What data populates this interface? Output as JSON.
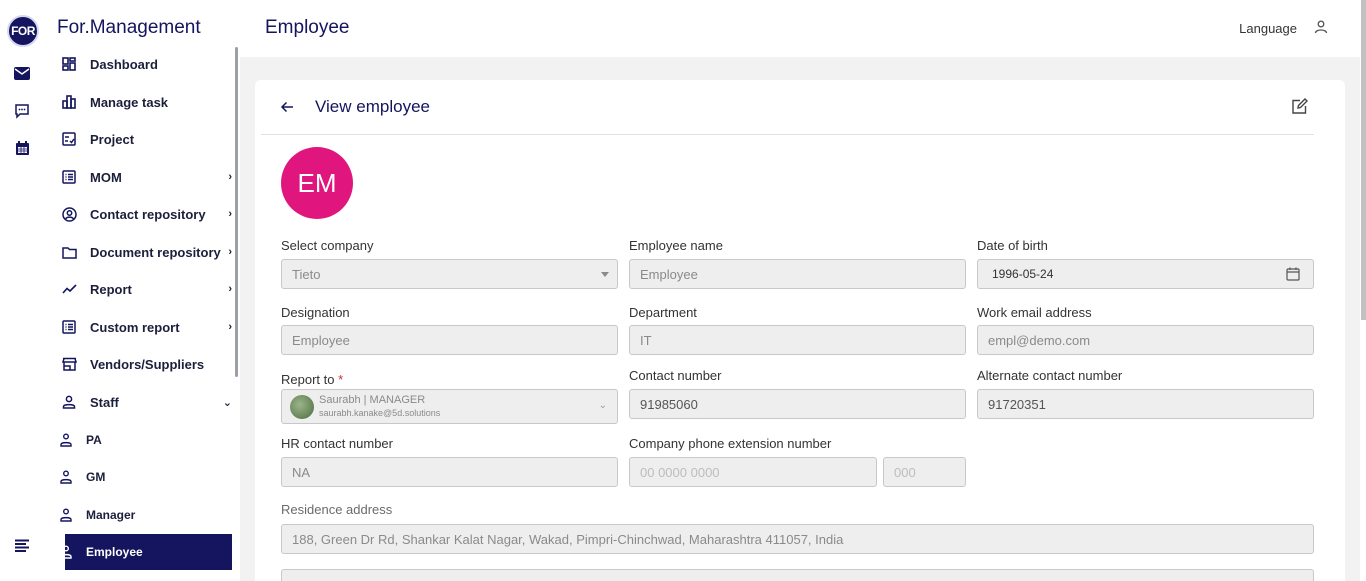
{
  "app": {
    "logo_text": "FOR",
    "brand": "For.Management"
  },
  "rail": {
    "icons": [
      "mail-icon",
      "chat-icon",
      "calendar-icon",
      "menu-icon"
    ]
  },
  "sidebar": {
    "items": [
      {
        "label": "Dashboard",
        "icon": "dashboard-icon"
      },
      {
        "label": "Manage task",
        "icon": "bar-chart-icon"
      },
      {
        "label": "Project",
        "icon": "project-icon"
      },
      {
        "label": "MOM",
        "icon": "list-icon",
        "chevron": "›"
      },
      {
        "label": "Contact repository",
        "icon": "contact-icon",
        "chevron": "›"
      },
      {
        "label": "Document repository",
        "icon": "folder-icon",
        "chevron": "›"
      },
      {
        "label": "Report",
        "icon": "trend-icon",
        "chevron": "›"
      },
      {
        "label": "Custom report",
        "icon": "list-icon",
        "chevron": "›"
      },
      {
        "label": "Vendors/Suppliers",
        "icon": "store-icon"
      },
      {
        "label": "Staff",
        "icon": "person-icon",
        "chevron": "⌄"
      }
    ],
    "staff_sub": [
      {
        "label": "PA"
      },
      {
        "label": "GM"
      },
      {
        "label": "Manager"
      },
      {
        "label": "Employee",
        "active": true
      }
    ]
  },
  "header": {
    "title": "Employee",
    "language": "Language"
  },
  "card": {
    "title": "View employee",
    "avatar_initials": "EM",
    "fields": {
      "company": {
        "label": "Select company",
        "value": "Tieto"
      },
      "employee_name": {
        "label": "Employee name",
        "value": "Employee"
      },
      "dob": {
        "label": "Date of birth",
        "value": "1996-05-24"
      },
      "designation": {
        "label": "Designation",
        "value": "Employee"
      },
      "department": {
        "label": "Department",
        "value": "IT"
      },
      "work_email": {
        "label": "Work email address",
        "value": "empl@demo.com"
      },
      "report_to": {
        "label": "Report to",
        "required_mark": "*",
        "name": "Saurabh | MANAGER",
        "email": "saurabh.kanake@5d.solutions"
      },
      "contact": {
        "label": "Contact number",
        "value": "91985060"
      },
      "alt_contact": {
        "label": "Alternate contact number",
        "value": "91720351"
      },
      "hr_contact": {
        "label": "HR contact number",
        "value": "NA"
      },
      "phone_ext": {
        "label": "Company phone extension number",
        "placeholder": "00 0000 0000",
        "ext_placeholder": "000"
      },
      "residence": {
        "label": "Residence address",
        "value": "188, Green Dr Rd, Shankar Kalat Nagar, Wakad, Pimpri-Chinchwad, Maharashtra 411057, India"
      }
    }
  },
  "colors": {
    "brand": "#14155e",
    "avatar": "#e0157e",
    "content_bg": "#f2f2f2"
  }
}
